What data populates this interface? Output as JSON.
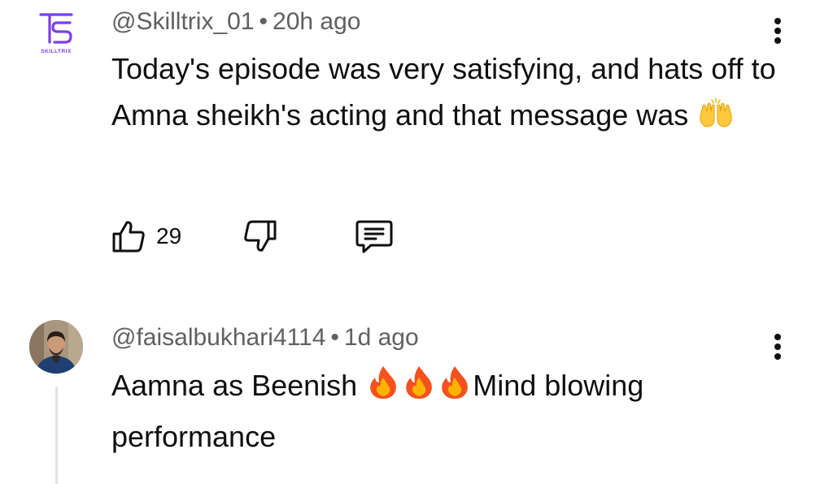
{
  "comments": [
    {
      "author": "@Skilltrix_01",
      "separator": "•",
      "time": "20h ago",
      "text_before_emoji": "Today's episode was very satisfying, and hats off to Amna sheikh's acting and that message was",
      "emoji": "raising-hands-emoji",
      "avatar_logo_text": "SKILLTRIX",
      "likes": "29",
      "icons": [
        "thumbs-up-icon",
        "thumbs-down-icon",
        "reply-icon",
        "more-vert-icon"
      ]
    },
    {
      "author": "@faisalbukhari4114",
      "separator": "•",
      "time": "1d ago",
      "text_part1": "Aamna as Beenish",
      "emojis": [
        "fire-emoji",
        "fire-emoji",
        "fire-emoji"
      ],
      "text_part2": "Mind blowing performance",
      "icons": [
        "more-vert-icon"
      ]
    }
  ],
  "colors": {
    "meta_text": "#606060",
    "body_text": "#0f0f0f",
    "logo_purple": "#7b3fe4",
    "thread_line": "#e2e2e2"
  }
}
